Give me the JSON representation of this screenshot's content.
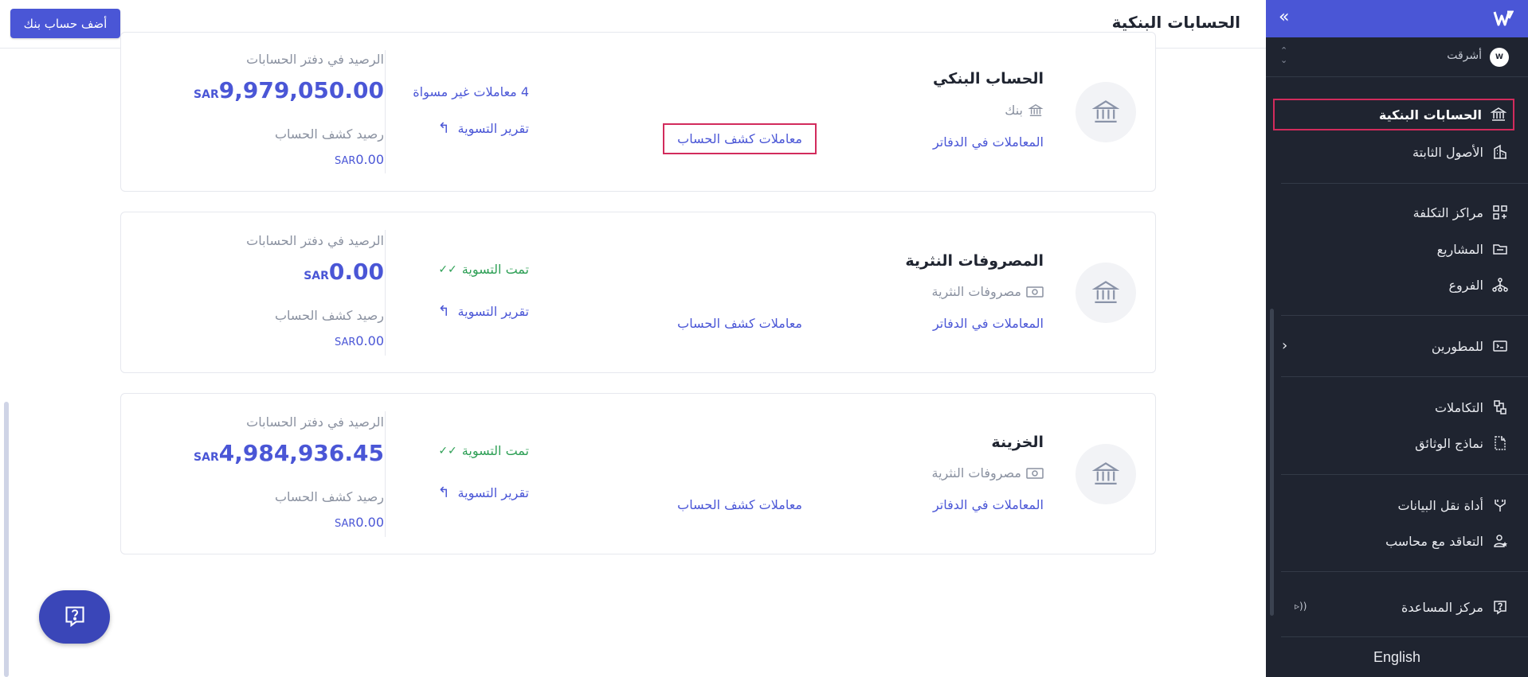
{
  "header": {
    "title": "الحسابات البنكية",
    "add_bank_label": "أضف حساب بنك"
  },
  "sidebar": {
    "org_name": "أشرقت",
    "org_avatar": "W",
    "items": [
      {
        "label": "الحسابات البنكية",
        "icon": "bank-icon",
        "active": true
      },
      {
        "label": "الأصول الثابتة",
        "icon": "building-icon"
      },
      {
        "label": "مراكز التكلفة",
        "icon": "grid-plus-icon"
      },
      {
        "label": "المشاريع",
        "icon": "folder-icon"
      },
      {
        "label": "الفروع",
        "icon": "branches-icon"
      },
      {
        "label": "للمطورين",
        "icon": "terminal-icon"
      },
      {
        "label": "التكاملات",
        "icon": "integrations-icon"
      },
      {
        "label": "نماذج الوثائق",
        "icon": "document-template-icon"
      },
      {
        "label": "أداة نقل البيانات",
        "icon": "data-transfer-icon"
      },
      {
        "label": "التعاقد مع محاسب",
        "icon": "accountant-icon"
      },
      {
        "label": "مركز المساعدة",
        "icon": "help-icon"
      }
    ],
    "language": "English"
  },
  "cards": [
    {
      "name": "الحساب البنكي",
      "type": "بنك",
      "book_link": "المعاملات في الدفاتر",
      "statement_link": "معاملات كشف الحساب",
      "recon_status": "4 معاملات غير مسواة",
      "recon_report": "تقرير التسوية",
      "ledger_label": "الرصيد في دفتر الحسابات",
      "ledger_amount": "9,979,050.00",
      "statement_label": "رصيد كشف الحساب",
      "statement_amount": "0.00",
      "currency": "SAR"
    },
    {
      "name": "المصروفات النثرية",
      "type": "مصروفات النثرية",
      "book_link": "المعاملات في الدفاتر",
      "statement_link": "معاملات كشف الحساب",
      "recon_status": "تمت التسوية",
      "recon_report": "تقرير التسوية",
      "ledger_label": "الرصيد في دفتر الحسابات",
      "ledger_amount": "0.00",
      "statement_label": "رصيد كشف الحساب",
      "statement_amount": "0.00",
      "currency": "SAR"
    },
    {
      "name": "الخزينة",
      "type": "مصروفات النثرية",
      "book_link": "المعاملات في الدفاتر",
      "statement_link": "معاملات كشف الحساب",
      "recon_status": "تمت التسوية",
      "recon_report": "تقرير التسوية",
      "ledger_label": "الرصيد في دفتر الحسابات",
      "ledger_amount": "4,984,936.45",
      "statement_label": "رصيد كشف الحساب",
      "statement_amount": "0.00",
      "currency": "SAR"
    }
  ],
  "colors": {
    "accent": "#4a56d6",
    "sidebar": "#1f2430",
    "success": "#2d9f55",
    "highlight": "#d22b5c"
  }
}
